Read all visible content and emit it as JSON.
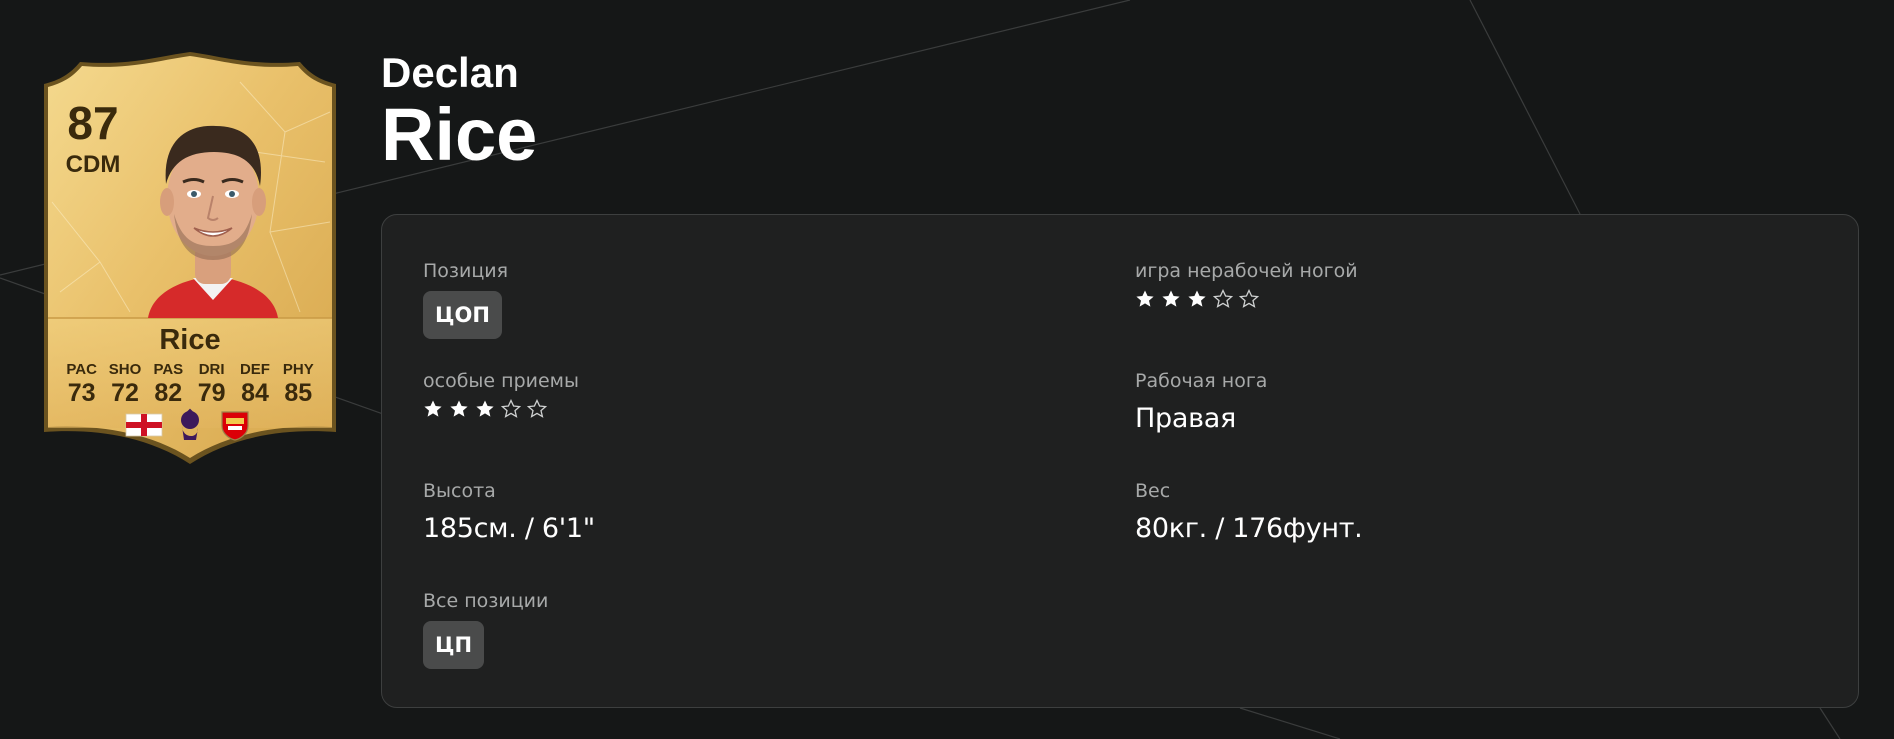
{
  "card": {
    "rating": "87",
    "position": "CDM",
    "name": "Rice",
    "stats": [
      {
        "label": "PAC",
        "value": "73"
      },
      {
        "label": "SHO",
        "value": "72"
      },
      {
        "label": "PAS",
        "value": "82"
      },
      {
        "label": "DRI",
        "value": "79"
      },
      {
        "label": "DEF",
        "value": "84"
      },
      {
        "label": "PHY",
        "value": "85"
      }
    ],
    "nation": "england-flag-icon",
    "league": "premier-league-icon",
    "club": "arsenal-crest-icon"
  },
  "player": {
    "first_name": "Declan",
    "last_name": "Rice"
  },
  "details": {
    "position_label": "Позиция",
    "position_value": "ЦОП",
    "weak_foot_label": "игра нерабочей ногой",
    "weak_foot_stars": 3,
    "skill_moves_label": "особые приемы",
    "skill_moves_stars": 3,
    "preferred_foot_label": "Рабочая нога",
    "preferred_foot_value": "Правая",
    "height_label": "Высота",
    "height_value": "185см. / 6'1\"",
    "weight_label": "Вес",
    "weight_value": "80кг. / 176фунт.",
    "alt_positions_label": "Все позиции",
    "alt_positions": [
      "ЦП"
    ],
    "max_stars": 5
  },
  "colors": {
    "background": "#151717",
    "panel": "#1f2020",
    "card_gold": "#e9c06a",
    "card_text": "#3a2a0c",
    "chip": "#4a4b4b"
  }
}
